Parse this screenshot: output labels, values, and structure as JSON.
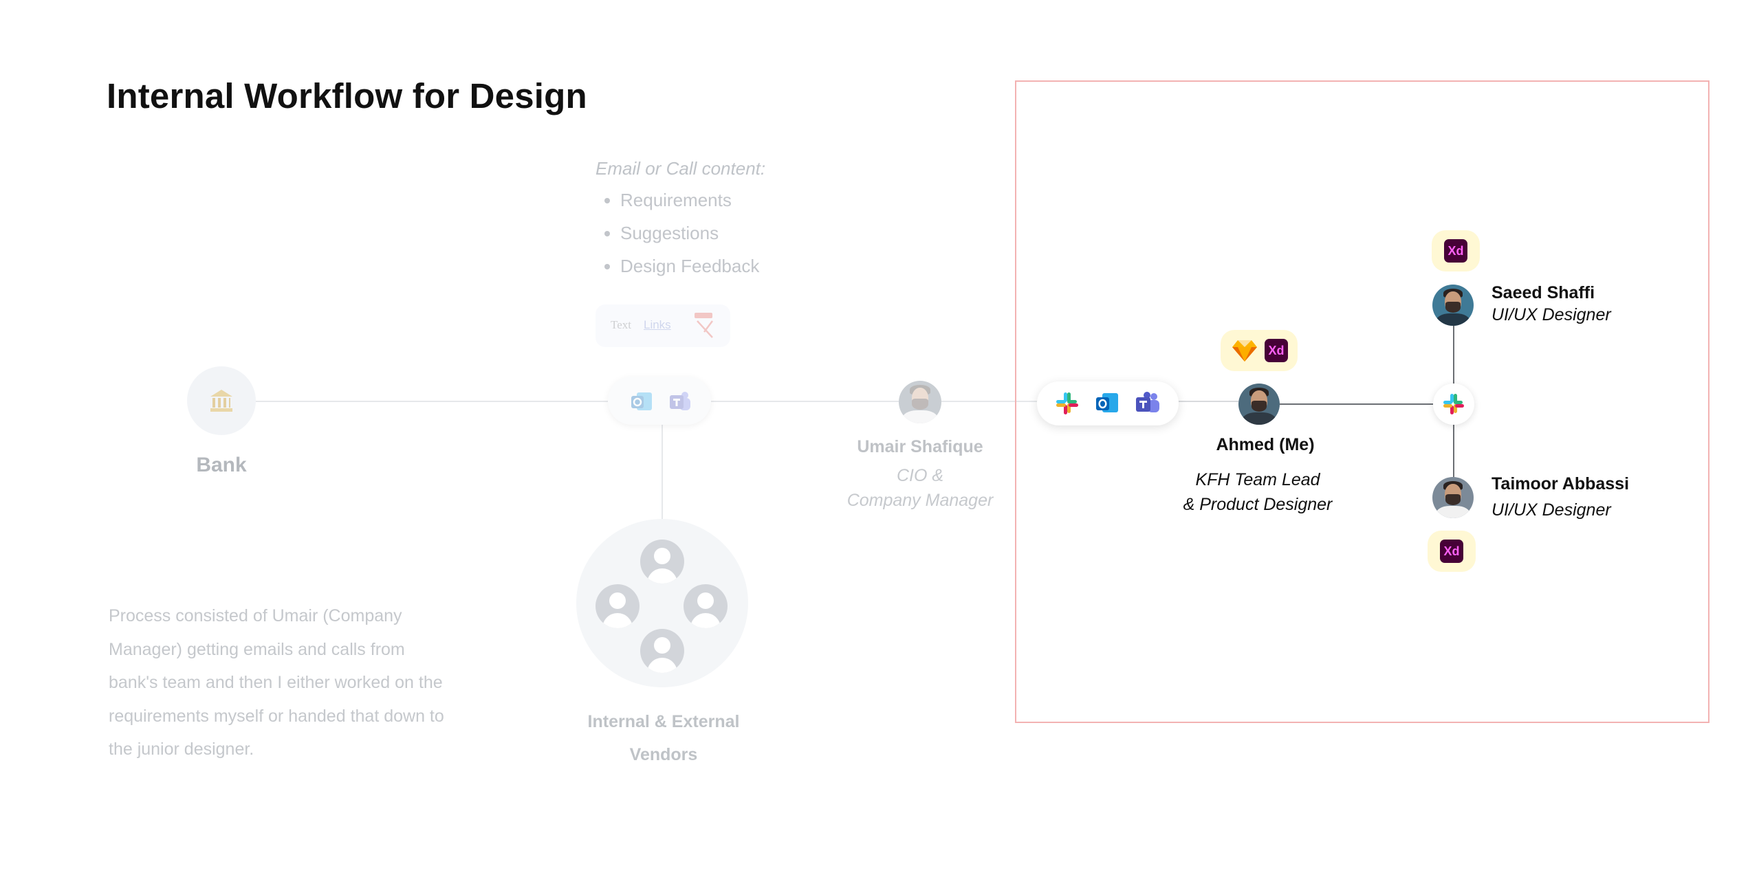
{
  "title": "Internal Workflow for Design",
  "email_panel": {
    "heading": "Email or Call content:",
    "items": [
      "Requirements",
      "Suggestions",
      "Design Feedback"
    ],
    "attachment_chip": {
      "text_label": "Text",
      "links_label": "Links"
    }
  },
  "nodes": {
    "bank": {
      "label": "Bank"
    },
    "vendors": {
      "label_line1": "Internal & External",
      "label_line2": "Vendors"
    },
    "umair": {
      "name": "Umair Shafique",
      "role_line1": "CIO &",
      "role_line2": "Company Manager"
    },
    "ahmed": {
      "name": "Ahmed (Me)",
      "role_line1": "KFH Team Lead",
      "role_line2": "& Product Designer",
      "tools": [
        "sketch-icon",
        "adobe-xd-icon"
      ]
    },
    "saeed": {
      "name": "Saeed Shaffi",
      "role": "UI/UX Designer",
      "tools": [
        "adobe-xd-icon"
      ]
    },
    "taimoor": {
      "name": "Taimoor Abbassi",
      "role": "UI/UX Designer",
      "tools": [
        "adobe-xd-icon"
      ]
    }
  },
  "communication_tools": [
    "slack-icon",
    "outlook-icon",
    "teams-icon"
  ],
  "xd_label": "Xd",
  "process_description": "Process consisted of Umair (Company Manager) getting emails and calls from bank's team and then I either worked on the requirements myself or handed that down to the junior designer.",
  "colors": {
    "highlight_frame": "#f3b2b2",
    "xd_bg": "#470137",
    "xd_fg": "#ff61f6",
    "tool_badge_bg": "#fff8d4"
  }
}
